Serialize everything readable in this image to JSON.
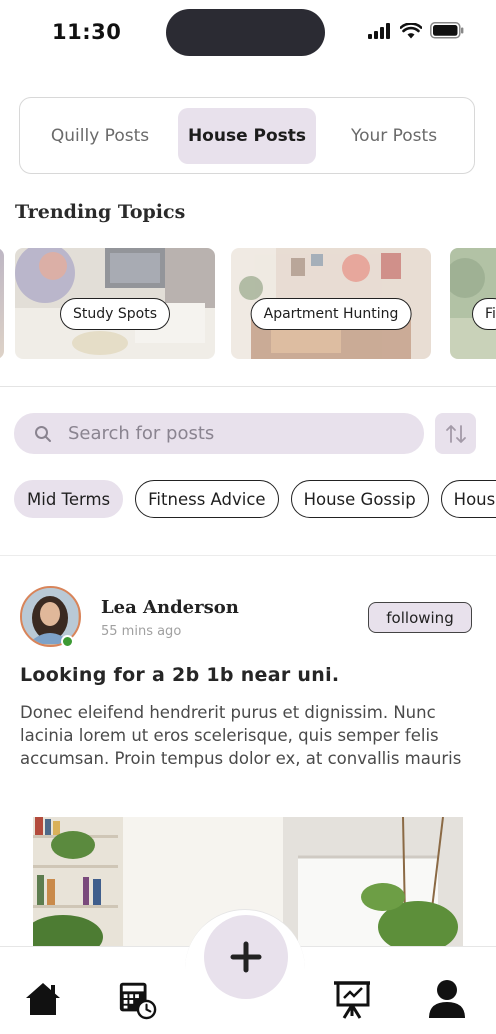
{
  "status": {
    "time": "11:30",
    "icons": [
      "cellular-icon",
      "wifi-icon",
      "battery-icon"
    ]
  },
  "tabs": [
    {
      "label": "Quilly Posts",
      "active": false
    },
    {
      "label": "House Posts",
      "active": true
    },
    {
      "label": "Your Posts",
      "active": false
    }
  ],
  "trending": {
    "title": "Trending Topics",
    "topics": [
      "Study Spots",
      "Apartment Hunting",
      "Fi"
    ]
  },
  "search": {
    "placeholder": "Search for posts"
  },
  "filters": [
    {
      "label": "Mid Terms",
      "active": true
    },
    {
      "label": "Fitness Advice",
      "active": false
    },
    {
      "label": "House Gossip",
      "active": false
    },
    {
      "label": "House",
      "active": false
    }
  ],
  "post": {
    "author": "Lea Anderson",
    "time": "55 mins ago",
    "follow_label": "following",
    "title": "Looking for a 2b 1b near uni.",
    "body": "Donec eleifend hendrerit purus et dignissim. Nunc lacinia lorem ut eros scelerisque, quis semper felis accumsan. Proin tempus dolor ex, at convallis mauris"
  },
  "nav": {
    "items": [
      "home-icon",
      "calendar-clock-icon",
      "add-icon",
      "presentation-icon",
      "profile-icon"
    ]
  },
  "colors": {
    "accent": "#e8e1ec",
    "online": "#3d9a34",
    "avatar_ring": "#d8845a"
  }
}
